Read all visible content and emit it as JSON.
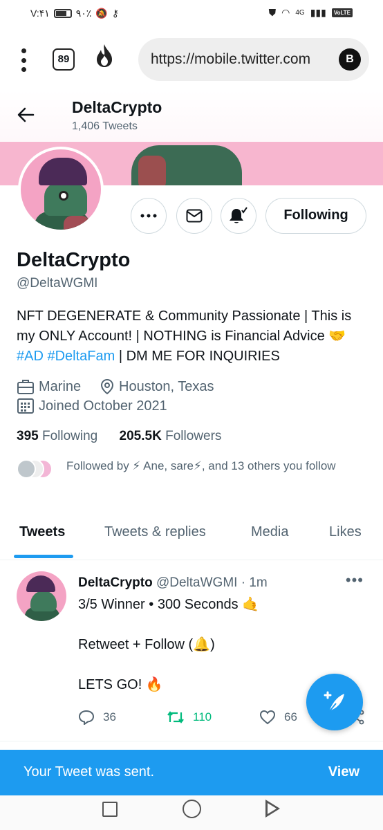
{
  "status_bar": {
    "time": "V:۴۱",
    "battery": "۹۰٪",
    "network": "4G",
    "volte": "VoLTE"
  },
  "browser": {
    "tab_count": "89",
    "url": "https://mobile.twitter.com",
    "account_initial": "B"
  },
  "header": {
    "name": "DeltaCrypto",
    "tweet_count": "1,406 Tweets"
  },
  "profile": {
    "name": "DeltaCrypto",
    "handle": "@DeltaWGMI",
    "follow_state": "Following",
    "bio_part1": "NFT DEGENERATE & Community Passionate | This is my ONLY Account! | NOTHING is Financial Advice 🤝 ",
    "bio_tag1": "#AD",
    "bio_tag2": "#DeltaFam",
    "bio_part2": " | DM ME FOR INQUIRIES",
    "location_work": "Marine",
    "location": "Houston, Texas",
    "joined": "Joined October 2021",
    "following_count": "395",
    "following_label": "Following",
    "followers_count": "205.5K",
    "followers_label": "Followers",
    "followed_by": "Followed by ⚡ Ane, sare⚡, and 13 others you follow"
  },
  "tabs": [
    {
      "label": "Tweets"
    },
    {
      "label": "Tweets & replies"
    },
    {
      "label": "Media"
    },
    {
      "label": "Likes"
    }
  ],
  "tweet": {
    "name": "DeltaCrypto",
    "meta": "@DeltaWGMI · 1m",
    "text": "3/5 Winner • 300 Seconds 🤙\n\nRetweet + Follow (🔔)\n\nLETS GO! 🔥",
    "replies": "36",
    "retweets": "110",
    "likes": "66"
  },
  "toast": {
    "message": "Your Tweet was sent.",
    "action": "View"
  },
  "colors": {
    "accent": "#1d9bf0",
    "retweet_green": "#00ba7c",
    "banner_pink": "#f7b6cf"
  }
}
